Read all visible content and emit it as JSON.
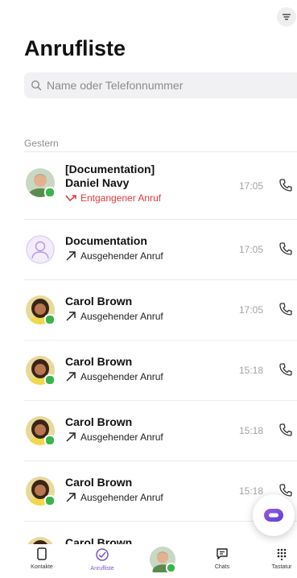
{
  "header": {
    "title": "Anrufliste"
  },
  "search": {
    "placeholder": "Name oder Telefonnummer"
  },
  "section_label": "Gestern",
  "calls": [
    {
      "name_line1": "[Documentation]",
      "name_line2": "Daniel Navy",
      "type": "Entgangener Anruf",
      "time": "17:05",
      "avatar": "photo-man",
      "presence": true
    },
    {
      "name_line1": "Documentation",
      "type": "Ausgehender Anruf",
      "time": "17:05",
      "avatar": "generic-user-icon",
      "presence": false
    },
    {
      "name_line1": "Carol Brown",
      "type": "Ausgehender Anruf",
      "time": "17:05",
      "avatar": "photo-woman",
      "presence": true
    },
    {
      "name_line1": "Carol Brown",
      "type": "Ausgehender Anruf",
      "time": "15:18",
      "avatar": "photo-woman",
      "presence": true
    },
    {
      "name_line1": "Carol Brown",
      "type": "Ausgehender Anruf",
      "time": "15:18",
      "avatar": "photo-woman",
      "presence": true
    },
    {
      "name_line1": "Carol Brown",
      "type": "Ausgehender Anruf",
      "time": "15:18",
      "avatar": "photo-woman",
      "presence": true
    },
    {
      "name_line1": "Carol Brown"
    }
  ],
  "tabbar": [
    {
      "label": "Kontakte",
      "icon": "contacts-icon"
    },
    {
      "label": "Anrufliste",
      "icon": "call-history-icon",
      "active": true
    },
    {
      "label": "",
      "icon": "profile-avatar"
    },
    {
      "label": "Chats",
      "icon": "chat-icon"
    },
    {
      "label": "Tastatur",
      "icon": "dialpad-icon"
    }
  ],
  "colors": {
    "accent": "#7a55c9",
    "missed": "#e0383e",
    "presence": "#3ab54a",
    "time": "#a3a3a8"
  }
}
